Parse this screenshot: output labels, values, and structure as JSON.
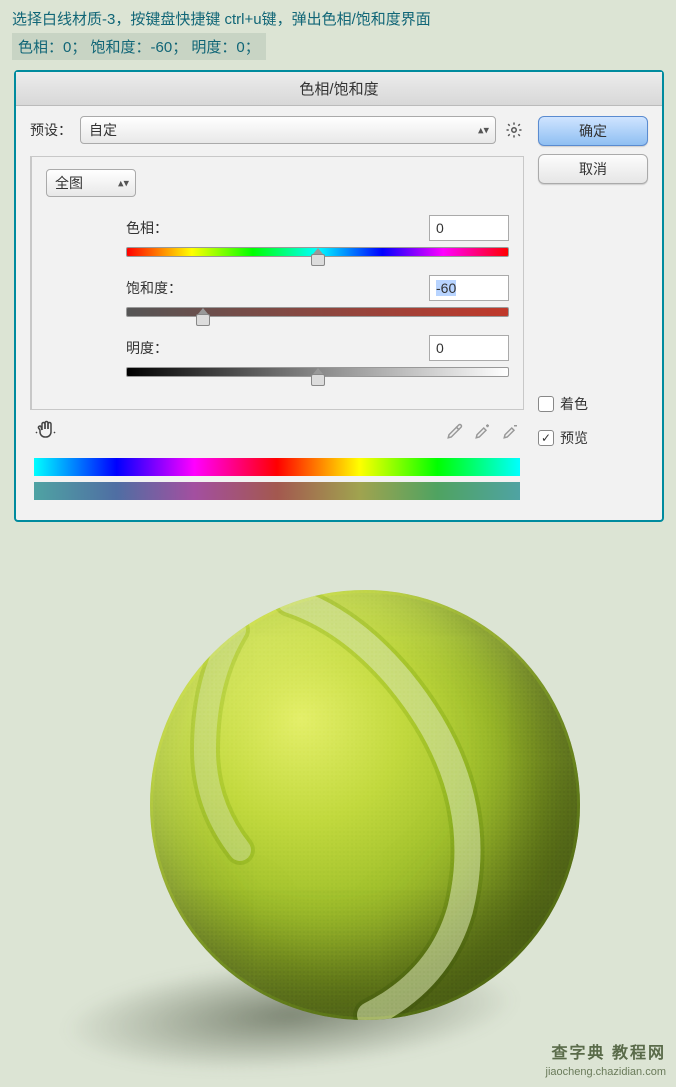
{
  "instruction": "选择白线材质-3，按键盘快捷键 ctrl+u键，弹出色相/饱和度界面",
  "values_line": "色相：0；    饱和度：-60；    明度：0；",
  "dialog": {
    "title": "色相/饱和度",
    "preset_label": "预设：",
    "preset_value": "自定",
    "ok": "确定",
    "cancel": "取消",
    "scope": "全图",
    "hue_label": "色相：",
    "hue_value": "0",
    "sat_label": "饱和度：",
    "sat_value": "-60",
    "light_label": "明度：",
    "light_value": "0",
    "colorize_label": "着色",
    "preview_label": "预览",
    "preview_checked": "✓"
  },
  "watermark": {
    "line1": "查字典 教程网",
    "line2": "jiaocheng.chazidian.com"
  }
}
